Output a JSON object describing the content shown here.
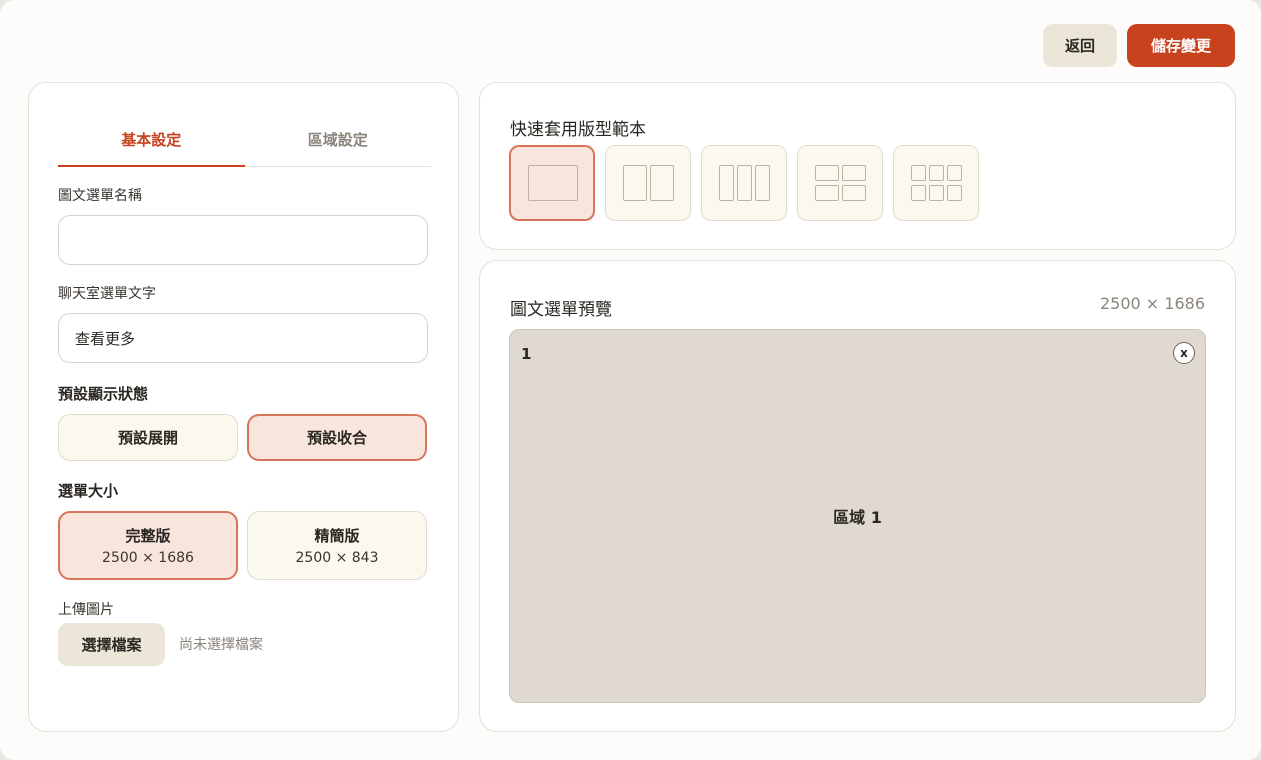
{
  "header": {
    "back_label": "返回",
    "save_label": "儲存變更"
  },
  "tabs": [
    {
      "label": "基本設定",
      "active": true
    },
    {
      "label": "區域設定",
      "active": false
    }
  ],
  "form": {
    "name_label": "圖文選單名稱",
    "name_value": "",
    "chat_label": "聊天室選單文字",
    "chat_value": "查看更多",
    "display_label": "預設顯示狀態",
    "display_options": [
      {
        "label": "預設展開",
        "selected": false
      },
      {
        "label": "預設收合",
        "selected": true
      }
    ],
    "size_label": "選單大小",
    "size_options": [
      {
        "label": "完整版",
        "dims": "2500 × 1686",
        "selected": true
      },
      {
        "label": "精簡版",
        "dims": "2500 × 843",
        "selected": false
      }
    ],
    "upload_label": "上傳圖片",
    "upload_button": "選擇檔案",
    "upload_status": "尚未選擇檔案"
  },
  "templates": {
    "title": "快速套用版型範本",
    "items": [
      {
        "icon": "layout-1-icon",
        "selected": true
      },
      {
        "icon": "layout-2-columns-icon",
        "selected": false
      },
      {
        "icon": "layout-3-columns-icon",
        "selected": false
      },
      {
        "icon": "layout-2x2-grid-icon",
        "selected": false
      },
      {
        "icon": "layout-3x2-grid-icon",
        "selected": false
      }
    ]
  },
  "preview": {
    "title": "圖文選單預覽",
    "dims": "2500 × 1686",
    "area_number": "1",
    "area_close": "x",
    "area_label": "區域 1"
  },
  "colors": {
    "accent": "#c8421e",
    "selected_bg": "#f8e6dd",
    "canvas_bg": "#e0d9d1"
  }
}
